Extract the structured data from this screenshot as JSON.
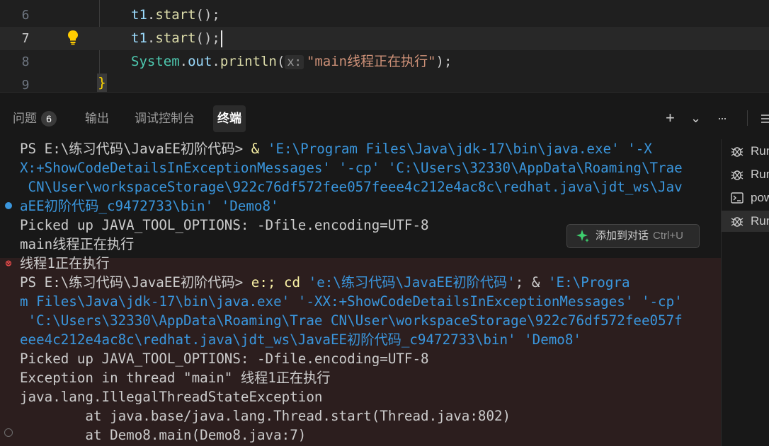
{
  "editor": {
    "lines": [
      {
        "num": "6",
        "var": "t1",
        "dot": ".",
        "fn": "start",
        "rest": "();"
      },
      {
        "num": "7",
        "var": "t1",
        "dot": ".",
        "fn": "start",
        "rest": "();"
      },
      {
        "num": "8",
        "cls": "System",
        "dot1": ".",
        "field": "out",
        "dot2": ".",
        "fn": "println",
        "open": "(",
        "hint": "x:",
        "str": "\"main线程正在执行\"",
        "close": ");"
      },
      {
        "num": "9",
        "brace": "}"
      }
    ]
  },
  "panel": {
    "tabs": [
      {
        "label": "问题",
        "badge": "6"
      },
      {
        "label": "输出"
      },
      {
        "label": "调试控制台"
      },
      {
        "label": "终端"
      }
    ],
    "active_tab": "终端",
    "tools": {
      "add": "+",
      "chevron": "⌄",
      "more": "···"
    }
  },
  "terminal": {
    "lines": [
      {
        "prompt": "PS E:\\练习代码\\JavaEE初阶代码> ",
        "cmd": "& ",
        "path": "'E:\\Program Files\\Java\\jdk-17\\bin\\java.exe' '-X"
      },
      {
        "path": "X:+ShowCodeDetailsInExceptionMessages' '-cp' 'C:\\Users\\32330\\AppData\\Roaming\\Trae"
      },
      {
        "path": " CN\\User\\workspaceStorage\\922c76df572fee057feee4c212e4ac8c\\redhat.java\\jdt_ws\\Jav"
      },
      {
        "path": "aEE初阶代码_c9472733\\bin' 'Demo8'"
      },
      {
        "text": "Picked up JAVA_TOOL_OPTIONS: -Dfile.encoding=UTF-8"
      },
      {
        "text": "main线程正在执行"
      },
      {
        "text": "线程1正在执行"
      },
      {
        "prompt": "PS E:\\练习代码\\JavaEE初阶代码> ",
        "cmd": "e:; cd ",
        "path": "'e:\\练习代码\\JavaEE初阶代码'",
        "cmd2": "; & ",
        "path2": "'E:\\Progra"
      },
      {
        "path": "m Files\\Java\\jdk-17\\bin\\java.exe' '-XX:+ShowCodeDetailsInExceptionMessages' '-cp'"
      },
      {
        "path": " 'C:\\Users\\32330\\AppData\\Roaming\\Trae CN\\User\\workspaceStorage\\922c76df572fee057f"
      },
      {
        "path": "eee4c212e4ac8c\\redhat.java\\jdt_ws\\JavaEE初阶代码_c9472733\\bin' 'Demo8'"
      },
      {
        "text": "Picked up JAVA_TOOL_OPTIONS: -Dfile.encoding=UTF-8"
      },
      {
        "text": "Exception in thread \"main\" 线程1正在执行"
      },
      {
        "text": "java.lang.IllegalThreadStateException"
      },
      {
        "text": "        at java.base/java.lang.Thread.start(Thread.java:802)"
      },
      {
        "text": "        at Demo8.main(Demo8.java:7)"
      }
    ],
    "chat_button": {
      "label": "添加到对话",
      "shortcut": "Ctrl+U"
    },
    "error_mark": "⊗"
  },
  "terminal_list": [
    {
      "label": "Run",
      "icon": "debug-icon"
    },
    {
      "label": "Run",
      "icon": "debug-icon"
    },
    {
      "label": "pow",
      "icon": "terminal-icon"
    },
    {
      "label": "Run",
      "icon": "debug-icon"
    }
  ],
  "colors": {
    "path": "#3a96dd",
    "command": "#f9f1a5",
    "error_background": "#2c1e1e"
  }
}
